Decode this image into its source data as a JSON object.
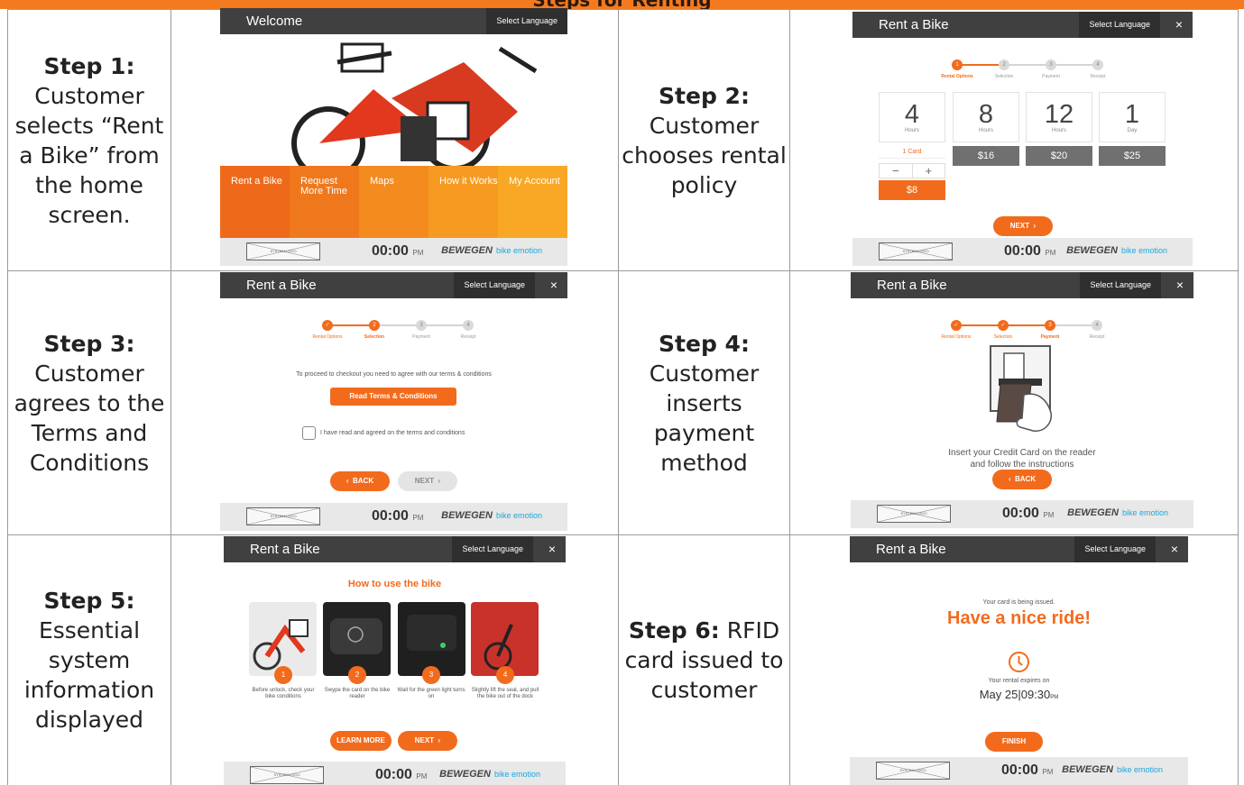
{
  "page": {
    "heading": "Steps for Renting"
  },
  "colors": {
    "accent": "#f26b1d",
    "header": "#404040",
    "footer": "#e8e8e8"
  },
  "kiosk": {
    "select_language": "Select Language",
    "close_symbol": "×",
    "time": "00:00",
    "time_suffix": "PM",
    "system_logo": "SYSTEM LOGO",
    "brand_left": "BEWEGEN",
    "brand_right": "bike emotion",
    "rent_title": "Rent a Bike",
    "stepper_labels": [
      "Rental Options",
      "Selection",
      "Payment",
      "Receipt"
    ]
  },
  "steps": [
    {
      "title": "Step 1:",
      "body": "Customer selects “Rent a Bike” from the home screen."
    },
    {
      "title": "Step 2:",
      "body": "Customer chooses rental policy"
    },
    {
      "title": "Step 3:",
      "body": "Customer agrees to the Terms and Conditions"
    },
    {
      "title": "Step 4:",
      "body": "Customer inserts payment method"
    },
    {
      "title": "Step 5:",
      "body": "Essential system information displayed"
    },
    {
      "title": "Step 6:",
      "body": "RFID card issued to customer"
    }
  ],
  "screen1": {
    "title": "Welcome",
    "tiles": [
      "Rent a Bike",
      "Request More Time",
      "Maps",
      "How it Works",
      "My Account"
    ],
    "tile_colors": [
      "#ee6a1a",
      "#f0781c",
      "#f48b1f",
      "#f69a21",
      "#f8a825"
    ]
  },
  "screen2": {
    "options": [
      {
        "num": "4",
        "unit": "Hours",
        "price": "$8",
        "qty_label": "1 Card"
      },
      {
        "num": "8",
        "unit": "Hours",
        "price": "$16"
      },
      {
        "num": "12",
        "unit": "Hours",
        "price": "$20"
      },
      {
        "num": "1",
        "unit": "Day",
        "price": "$25"
      }
    ],
    "minus": "−",
    "plus": "+",
    "next": "NEXT"
  },
  "screen3": {
    "instruction": "To proceed to checkout you need to agree with our terms & conditions",
    "read_terms": "Read Terms & Conditions",
    "checkbox_label": "I have read and agreed on the terms and conditions",
    "back": "BACK",
    "next": "NEXT"
  },
  "screen4": {
    "instruction_line1": "Insert your Credit Card on the reader",
    "instruction_line2": "and follow the instructions",
    "back": "BACK"
  },
  "screen5": {
    "heading": "How to use the bike",
    "items": [
      {
        "n": "1",
        "text": "Before unlock, check your bike conditions"
      },
      {
        "n": "2",
        "text": "Swype the card on the bike reader"
      },
      {
        "n": "3",
        "text": "Wait for the green light turns on"
      },
      {
        "n": "4",
        "text": "Slightly lift the seat, and pull the bike out of the dock"
      }
    ],
    "learn_more": "LEARN MORE",
    "next": "NEXT"
  },
  "screen6": {
    "issued": "Your card is being issued.",
    "headline": "Have a nice ride!",
    "expires": "Your rental expires on",
    "date": "May 25",
    "sep": "|",
    "time": "09:30",
    "time_suffix": "PM",
    "finish": "FINISH"
  }
}
